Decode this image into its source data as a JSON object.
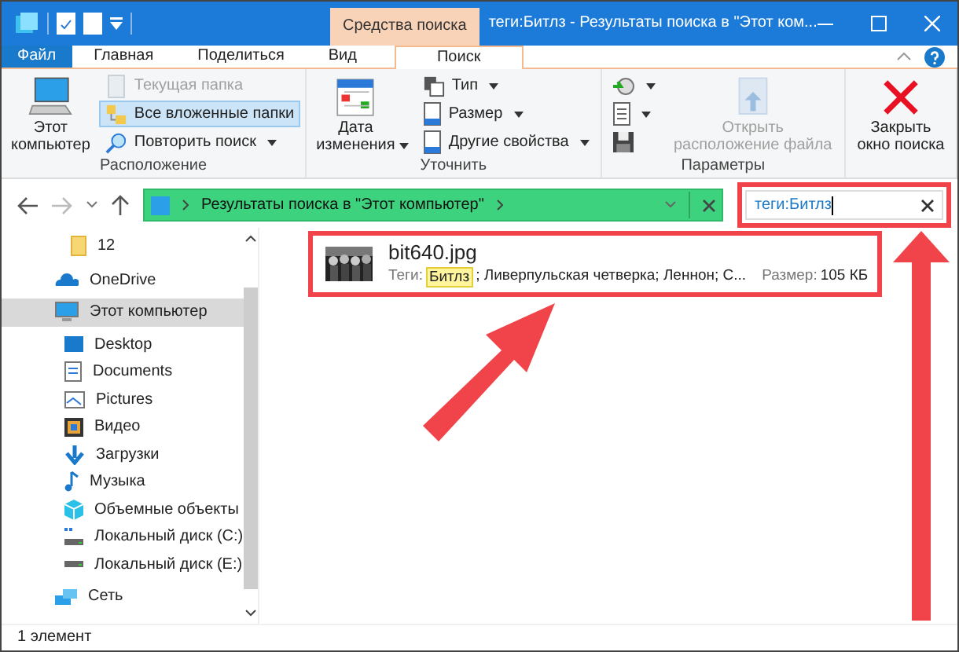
{
  "window": {
    "title": "теги:Битлз - Результаты поиска в \"Этот ком...",
    "context_tab": "Средства поиска"
  },
  "tabs": [
    {
      "label": "Файл",
      "kind": "file",
      "selected": false
    },
    {
      "label": "Главная",
      "kind": "tab",
      "selected": false
    },
    {
      "label": "Поделиться",
      "kind": "tab",
      "selected": false
    },
    {
      "label": "Вид",
      "kind": "tab",
      "selected": false
    },
    {
      "label": "Поиск",
      "kind": "context",
      "selected": true
    }
  ],
  "ribbon": {
    "groups": [
      {
        "label": "Расположение",
        "columns": [
          {
            "kind": "large",
            "label": "Этот компьютер",
            "disabled": false
          },
          {
            "kind": "stack",
            "items": [
              {
                "label": "Текущая папка",
                "dropdown": false,
                "disabled": true,
                "selected": false
              },
              {
                "label": "Все вложенные папки",
                "dropdown": false,
                "disabled": false,
                "selected": true
              },
              {
                "label": "Повторить поиск",
                "dropdown": true,
                "disabled": false,
                "selected": false
              }
            ]
          }
        ]
      },
      {
        "label": "Уточнить",
        "columns": [
          {
            "kind": "large",
            "label": "Дата изменения",
            "dropdown": true,
            "disabled": false
          },
          {
            "kind": "stack",
            "items": [
              {
                "label": "Тип",
                "dropdown": true,
                "disabled": false,
                "selected": false
              },
              {
                "label": "Размер",
                "dropdown": true,
                "disabled": false,
                "selected": false
              },
              {
                "label": "Другие свойства",
                "dropdown": true,
                "disabled": false,
                "selected": false
              }
            ]
          }
        ]
      },
      {
        "label": "Параметры",
        "columns": [
          {
            "kind": "stack",
            "items": [
              {
                "dropdown": true,
                "selected": false
              },
              {
                "dropdown": true,
                "selected": false
              },
              {
                "dropdown": false,
                "selected": false
              }
            ]
          },
          {
            "kind": "large",
            "label": "Открыть расположение файла",
            "disabled": true
          }
        ]
      },
      {
        "columns": [
          {
            "kind": "large",
            "label": "Закрыть окно поиска",
            "disabled": false
          }
        ]
      }
    ]
  },
  "address": {
    "path": "Результаты поиска в \"Этот компьютер\""
  },
  "search": {
    "value": "теги:Битлз",
    "highlighted": true
  },
  "navigation": {
    "quick_access_items": [
      {
        "label": "12",
        "selected": false
      }
    ],
    "items": [
      {
        "label": "OneDrive",
        "selected": false
      },
      {
        "label": "Этот компьютер",
        "selected": true,
        "children": [
          {
            "label": "Desktop",
            "selected": false
          },
          {
            "label": "Documents",
            "selected": false
          },
          {
            "label": "Pictures",
            "selected": false
          },
          {
            "label": "Видео",
            "selected": false
          },
          {
            "label": "Загрузки",
            "selected": false
          },
          {
            "label": "Музыка",
            "selected": false
          },
          {
            "label": "Объемные объекты",
            "selected": false
          },
          {
            "label": "Локальный диск (C:)",
            "selected": false
          },
          {
            "label": "Локальный диск (E:)",
            "selected": false
          }
        ]
      },
      {
        "label": "Сеть",
        "selected": false
      }
    ]
  },
  "results": [
    {
      "name": "bit640.jpg",
      "tags_label": "Теги:",
      "tags_match": "Битлз",
      "tags_rest": "; Ливерпульская четверка; Леннон; С...",
      "size_label": "Размер:",
      "size": "105 КБ",
      "highlighted": true
    }
  ],
  "status_bar": {
    "count": "1 элемент"
  }
}
